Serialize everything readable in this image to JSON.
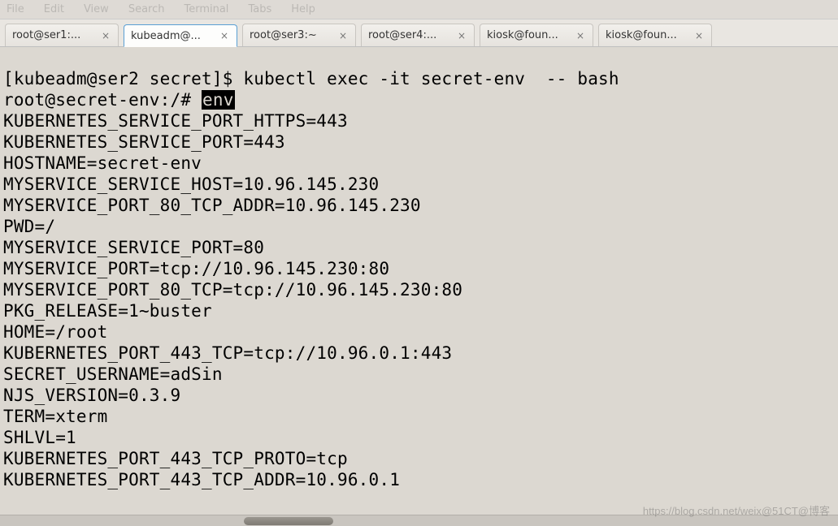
{
  "menu": {
    "items": [
      "File",
      "Edit",
      "View",
      "Search",
      "Terminal",
      "Tabs",
      "Help"
    ]
  },
  "tabs": [
    {
      "label": "root@ser1:...",
      "active": false
    },
    {
      "label": "kubeadm@...",
      "active": true
    },
    {
      "label": "root@ser3:~",
      "active": false
    },
    {
      "label": "root@ser4:...",
      "active": false
    },
    {
      "label": "kiosk@foun...",
      "active": false
    },
    {
      "label": "kiosk@foun...",
      "active": false
    }
  ],
  "terminal": {
    "prompt1_prefix": "[kubeadm@ser2 secret]$ ",
    "prompt1_cmd": "kubectl exec -it secret-env  -- bash",
    "prompt2_prefix": "root@secret-env:/# ",
    "prompt2_cmd": "env",
    "output": [
      "KUBERNETES_SERVICE_PORT_HTTPS=443",
      "KUBERNETES_SERVICE_PORT=443",
      "HOSTNAME=secret-env",
      "MYSERVICE_SERVICE_HOST=10.96.145.230",
      "MYSERVICE_PORT_80_TCP_ADDR=10.96.145.230",
      "PWD=/",
      "MYSERVICE_SERVICE_PORT=80",
      "MYSERVICE_PORT=tcp://10.96.145.230:80",
      "MYSERVICE_PORT_80_TCP=tcp://10.96.145.230:80",
      "PKG_RELEASE=1~buster",
      "HOME=/root",
      "KUBERNETES_PORT_443_TCP=tcp://10.96.0.1:443",
      "SECRET_USERNAME=adSin",
      "NJS_VERSION=0.3.9",
      "TERM=xterm",
      "SHLVL=1",
      "KUBERNETES_PORT_443_TCP_PROTO=tcp",
      "KUBERNETES_PORT_443_TCP_ADDR=10.96.0.1"
    ]
  },
  "watermark": "https://blog.csdn.net/weix@51CT@博客"
}
